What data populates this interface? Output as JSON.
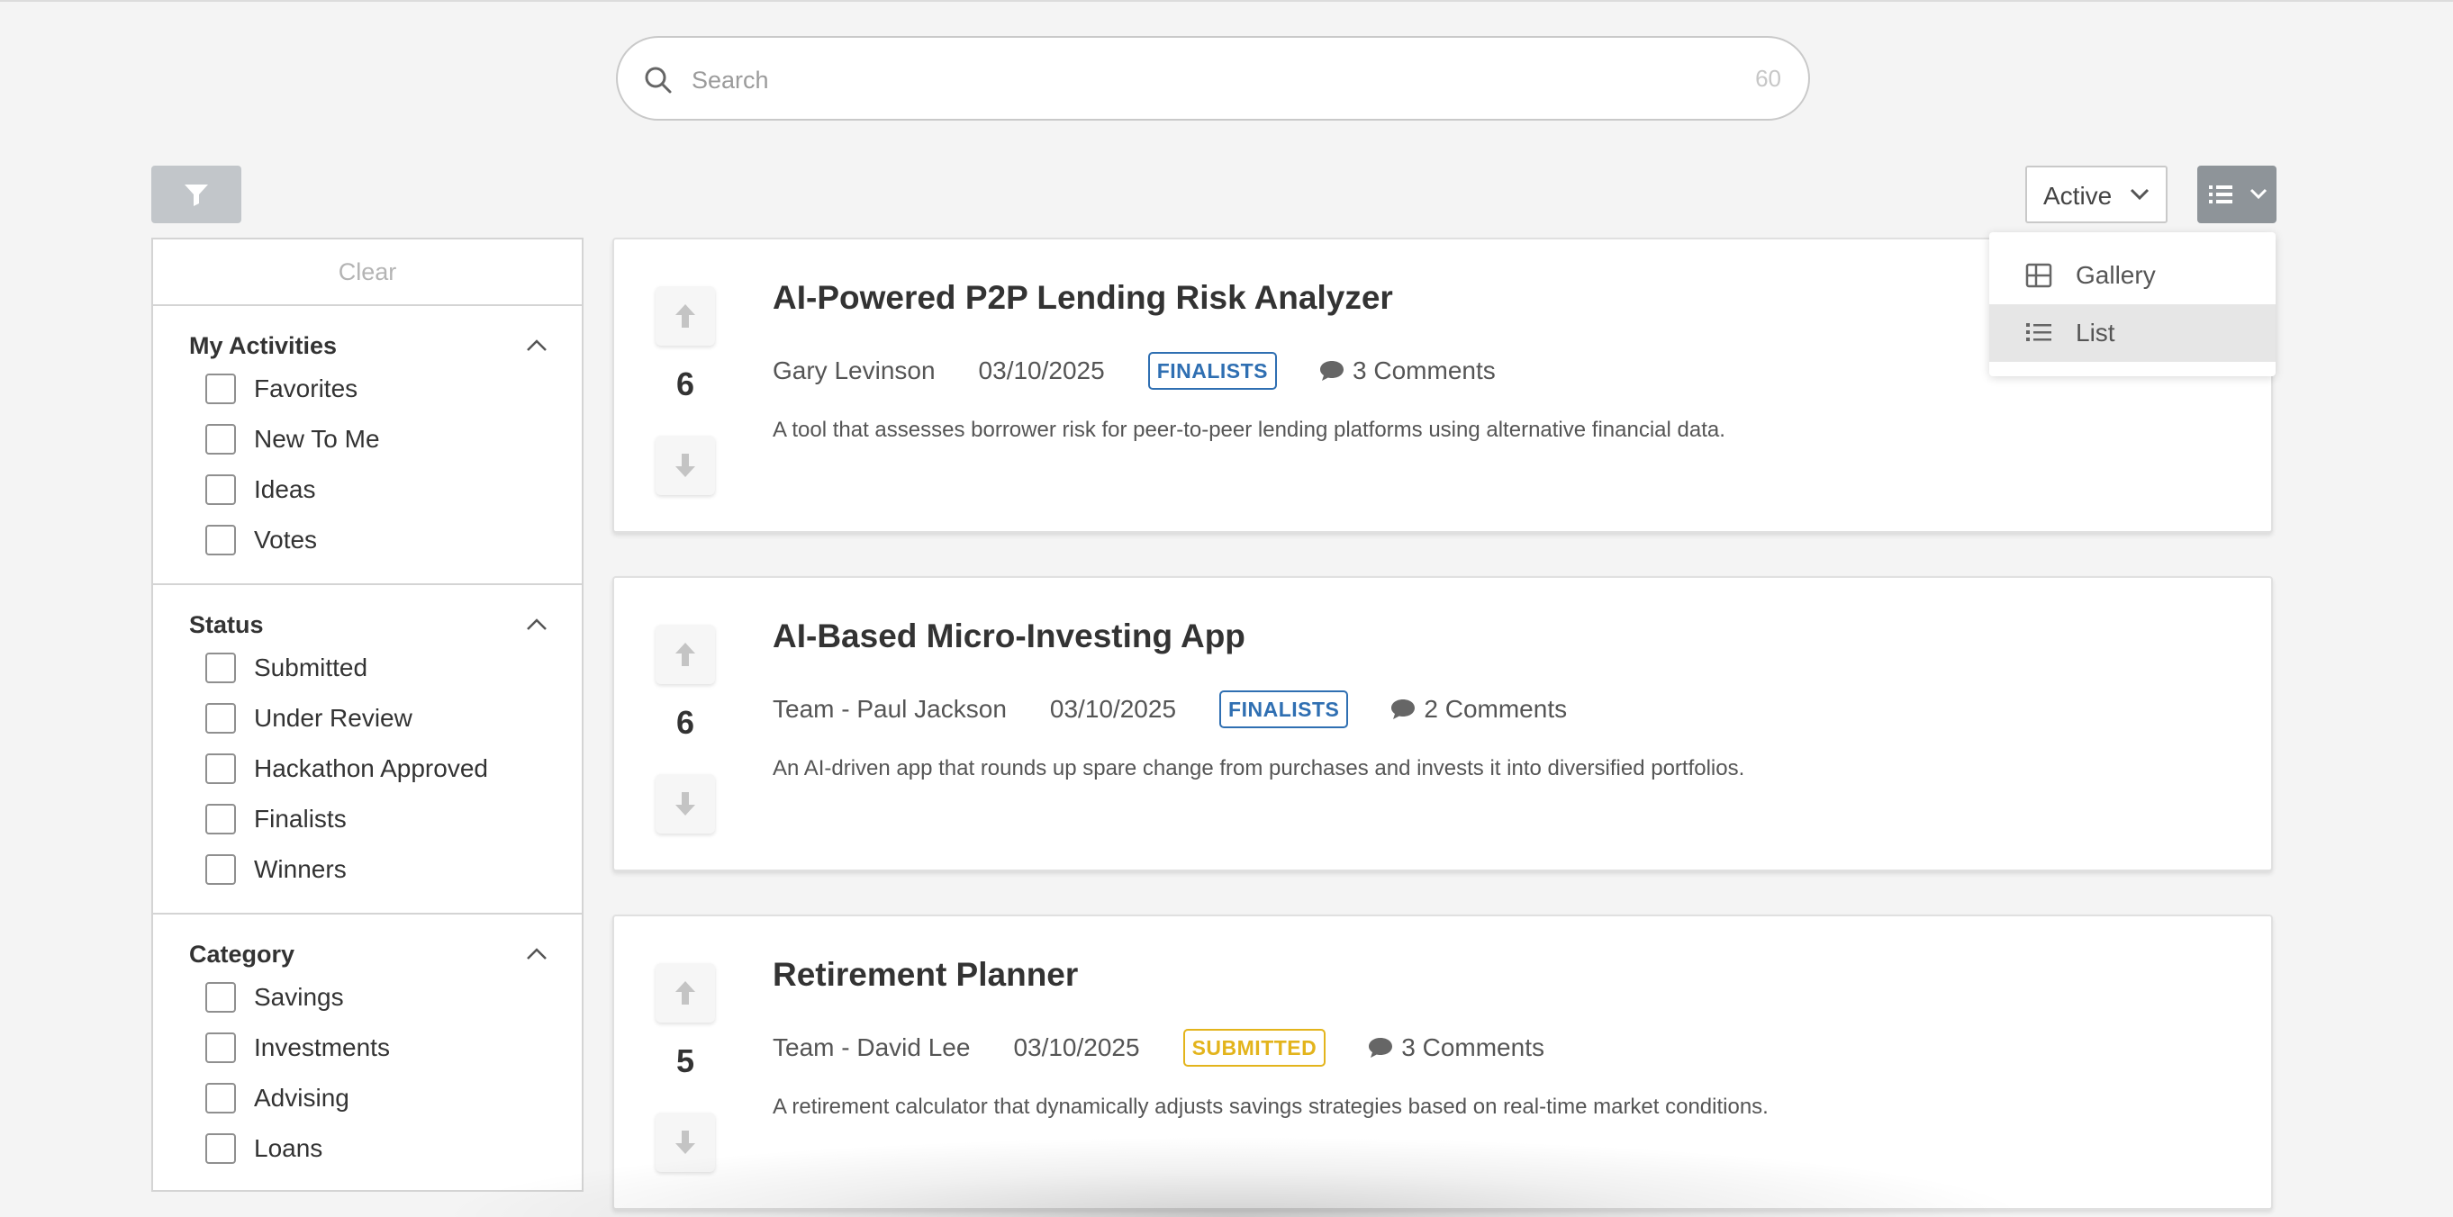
{
  "search": {
    "placeholder": "Search",
    "count": "60"
  },
  "filters": {
    "clear_label": "Clear",
    "groups": [
      {
        "title": "My Activities",
        "options": [
          "Favorites",
          "New To Me",
          "Ideas",
          "Votes"
        ]
      },
      {
        "title": "Status",
        "options": [
          "Submitted",
          "Under Review",
          "Hackathon Approved",
          "Finalists",
          "Winners"
        ]
      },
      {
        "title": "Category",
        "options": [
          "Savings",
          "Investments",
          "Advising",
          "Loans"
        ]
      }
    ]
  },
  "sort": {
    "selected": "Active"
  },
  "view_menu": {
    "items": [
      {
        "label": "Gallery",
        "icon": "grid-icon"
      },
      {
        "label": "List",
        "icon": "list-icon",
        "selected": true
      }
    ]
  },
  "ideas": [
    {
      "votes": "6",
      "title": "AI-Powered P2P Lending Risk Analyzer",
      "author": "Gary Levinson",
      "date": "03/10/2025",
      "status": "FINALISTS",
      "status_color": "#2f6fb2",
      "comments": "3 Comments",
      "description": "A tool that assesses borrower risk for peer-to-peer lending platforms using alternative financial data."
    },
    {
      "votes": "6",
      "title": "AI-Based Micro-Investing App",
      "author": "Team - Paul Jackson",
      "date": "03/10/2025",
      "status": "FINALISTS",
      "status_color": "#2f6fb2",
      "comments": "2 Comments",
      "description": "An AI-driven app that rounds up spare change from purchases and invests it into diversified portfolios."
    },
    {
      "votes": "5",
      "title": "Retirement Planner",
      "author": "Team - David Lee",
      "date": "03/10/2025",
      "status": "SUBMITTED",
      "status_color": "#e3b41c",
      "comments": "3 Comments",
      "description": "A retirement calculator that dynamically adjusts savings strategies based on real-time market conditions."
    }
  ]
}
